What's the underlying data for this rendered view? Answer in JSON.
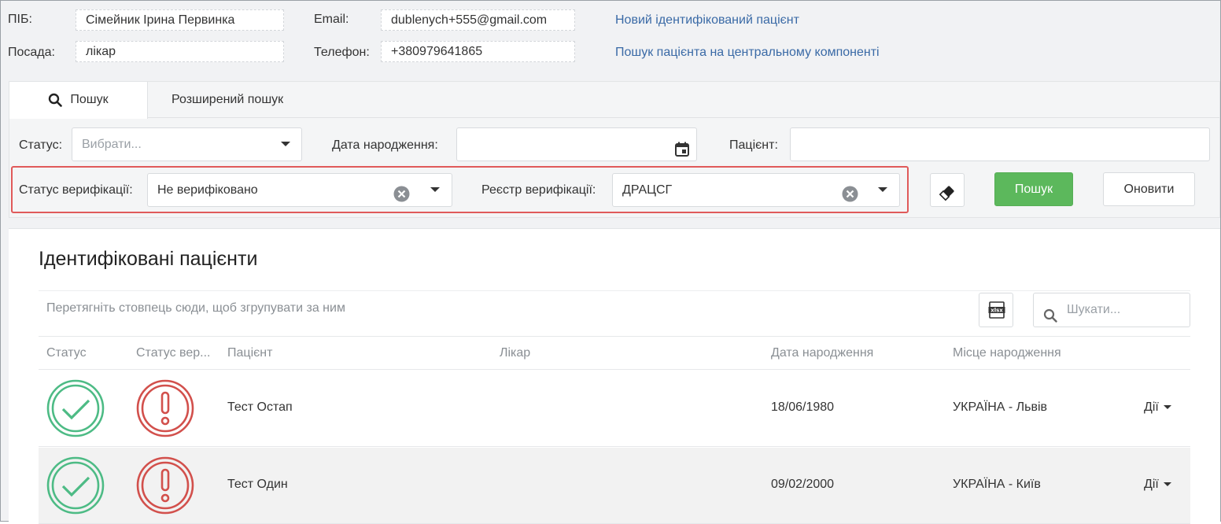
{
  "user": {
    "pib_label": "ПІБ:",
    "pib_value": "Сімейник Ірина Первинка",
    "position_label": "Посада:",
    "position_value": "лікар",
    "email_label": "Email:",
    "email_value": "dublenych+555@gmail.com",
    "phone_label": "Телефон:",
    "phone_value": "+380979641865"
  },
  "links": {
    "new_patient": "Новий ідентифікований пацієнт",
    "central_search": "Пошук пацієнта на центральному компоненті"
  },
  "tabs": [
    {
      "label": "Пошук",
      "icon": "search-icon",
      "active": true
    },
    {
      "label": "Розширений пошук",
      "active": false
    }
  ],
  "filters": {
    "status_label": "Статус:",
    "status_placeholder": "Вибрати...",
    "birth_label": "Дата народження:",
    "birth_value": "",
    "patient_label": "Пацієнт:",
    "patient_value": "",
    "verif_status_label": "Статус верифікації:",
    "verif_status_value": "Не верифіковано",
    "verif_registry_label": "Реєстр верифікації:",
    "verif_registry_value": "ДРАЦСГ",
    "search_button": "Пошук",
    "refresh_button": "Оновити",
    "clear_icon": "eraser-icon"
  },
  "grid": {
    "title": "Ідентифіковані пацієнти",
    "group_hint": "Перетягніть стовпець сюди, щоб згрупувати за ним",
    "search_placeholder": "Шукати...",
    "columns": [
      "Статус",
      "Статус вер...",
      "Пацієнт",
      "Лікар",
      "Дата народження",
      "Місце народження"
    ],
    "rows": [
      {
        "status": "ok",
        "verification": "warning",
        "patient": "Тест Остап",
        "doctor": "",
        "birth_date": "18/06/1980",
        "birth_place": "УКРАЇНА - Львів",
        "actions": "Дії"
      },
      {
        "status": "ok",
        "verification": "warning",
        "patient": "Тест Один",
        "doctor": "",
        "birth_date": "09/02/2000",
        "birth_place": "УКРАЇНА - Київ",
        "actions": "Дії"
      }
    ]
  },
  "colors": {
    "link": "#3a6aa6",
    "success": "#5cb85c",
    "status_ok": "#4dbb85",
    "status_warn": "#d2504c",
    "highlight": "#e05a5a"
  }
}
